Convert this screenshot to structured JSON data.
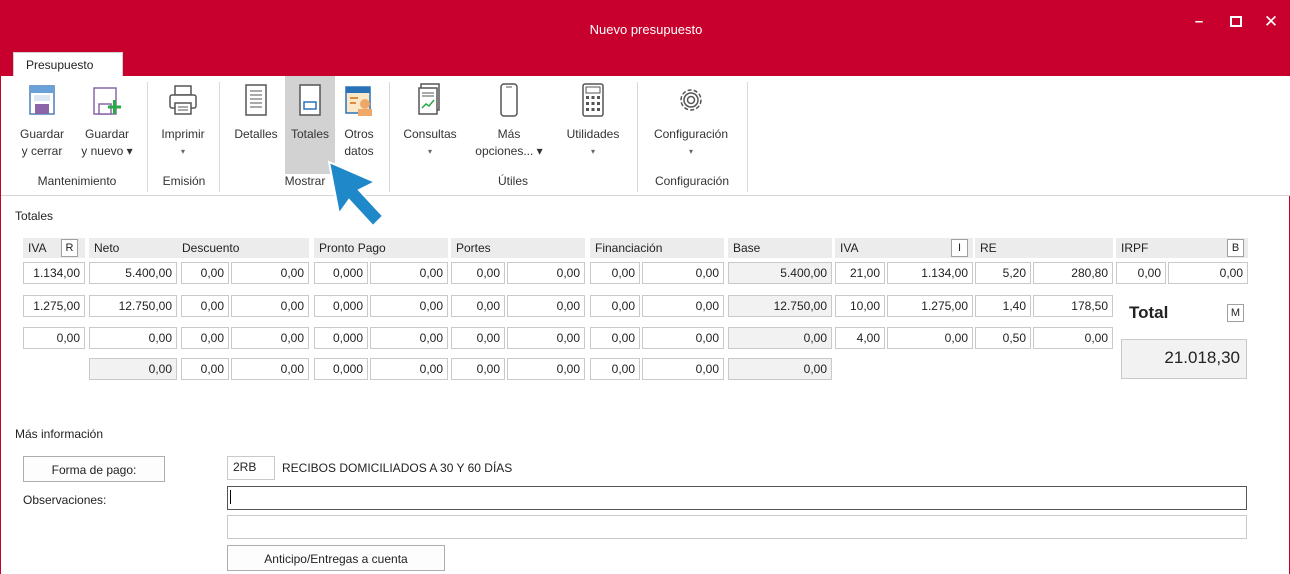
{
  "window": {
    "title": "Nuevo presupuesto"
  },
  "tab": {
    "label": "Presupuesto"
  },
  "ribbon": {
    "guardar_cerrar": [
      "Guardar",
      "y cerrar"
    ],
    "guardar_nuevo": [
      "Guardar",
      "y nuevo ▾"
    ],
    "imprimir": "Imprimir",
    "detalles": "Detalles",
    "totales": "Totales",
    "otros_datos": [
      "Otros",
      "datos"
    ],
    "consultas": "Consultas",
    "mas_opciones": [
      "Más",
      "opciones... ▾"
    ],
    "utilidades": "Utilidades",
    "configuracion": "Configuración",
    "groups": {
      "mantenimiento": "Mantenimiento",
      "emision": "Emisión",
      "mostrar": "Mostrar",
      "utiles": "Útiles",
      "configuracion": "Configuración"
    }
  },
  "totales": {
    "section_title": "Totales",
    "headers": {
      "iva": "IVA",
      "iva_btn": "R",
      "neto": "Neto",
      "descuento": "Descuento",
      "pronto_pago": "Pronto Pago",
      "portes": "Portes",
      "financiacion": "Financiación",
      "base": "Base",
      "iva2": "IVA",
      "iva2_btn": "I",
      "re": "RE",
      "irpf": "IRPF",
      "irpf_btn": "B"
    },
    "rows": [
      {
        "iva": "1.134,00",
        "neto": "5.400,00",
        "dto_p": "0,00",
        "dto": "0,00",
        "pp_p": "0,000",
        "pp": "0,00",
        "portes_p": "0,00",
        "portes": "0,00",
        "fin_p": "0,00",
        "fin": "0,00",
        "base": "5.400,00",
        "iva_p": "21,00",
        "re_p": "5,20",
        "re": "280,80"
      },
      {
        "iva": "1.275,00",
        "neto": "12.750,00",
        "dto_p": "0,00",
        "dto": "0,00",
        "pp_p": "0,000",
        "pp": "0,00",
        "portes_p": "0,00",
        "portes": "0,00",
        "fin_p": "0,00",
        "fin": "0,00",
        "base": "12.750,00",
        "iva_p": "10,00",
        "re_p": "1,40",
        "re": "178,50"
      },
      {
        "iva": "0,00",
        "neto": "0,00",
        "dto_p": "0,00",
        "dto": "0,00",
        "pp_p": "0,000",
        "pp": "0,00",
        "portes_p": "0,00",
        "portes": "0,00",
        "fin_p": "0,00",
        "fin": "0,00",
        "base": "0,00",
        "iva_p": "4,00",
        "re_p": "0,50",
        "re": "0,00"
      }
    ],
    "sum": {
      "neto": "0,00",
      "dto_p": "0,00",
      "dto": "0,00",
      "pp_p": "0,000",
      "pp": "0,00",
      "portes_p": "0,00",
      "portes": "0,00",
      "fin_p": "0,00",
      "fin": "0,00",
      "base": "0,00"
    },
    "irpf_p": "0,00",
    "irpf": "0,00",
    "total_label": "Total",
    "total_btn": "M",
    "total_value": "21.018,30"
  },
  "mas_info": {
    "section_title": "Más información",
    "forma_pago_btn": "Forma de pago:",
    "forma_pago_code": "2RB",
    "forma_pago_desc": "RECIBOS DOMICILIADOS A 30 Y 60 DÍAS",
    "observaciones_label": "Observaciones:",
    "observaciones_value": "",
    "anticipo_btn": "Anticipo/Entregas a cuenta"
  },
  "colors": {
    "brand": "#c8002d",
    "cursor": "#1e88c9"
  }
}
